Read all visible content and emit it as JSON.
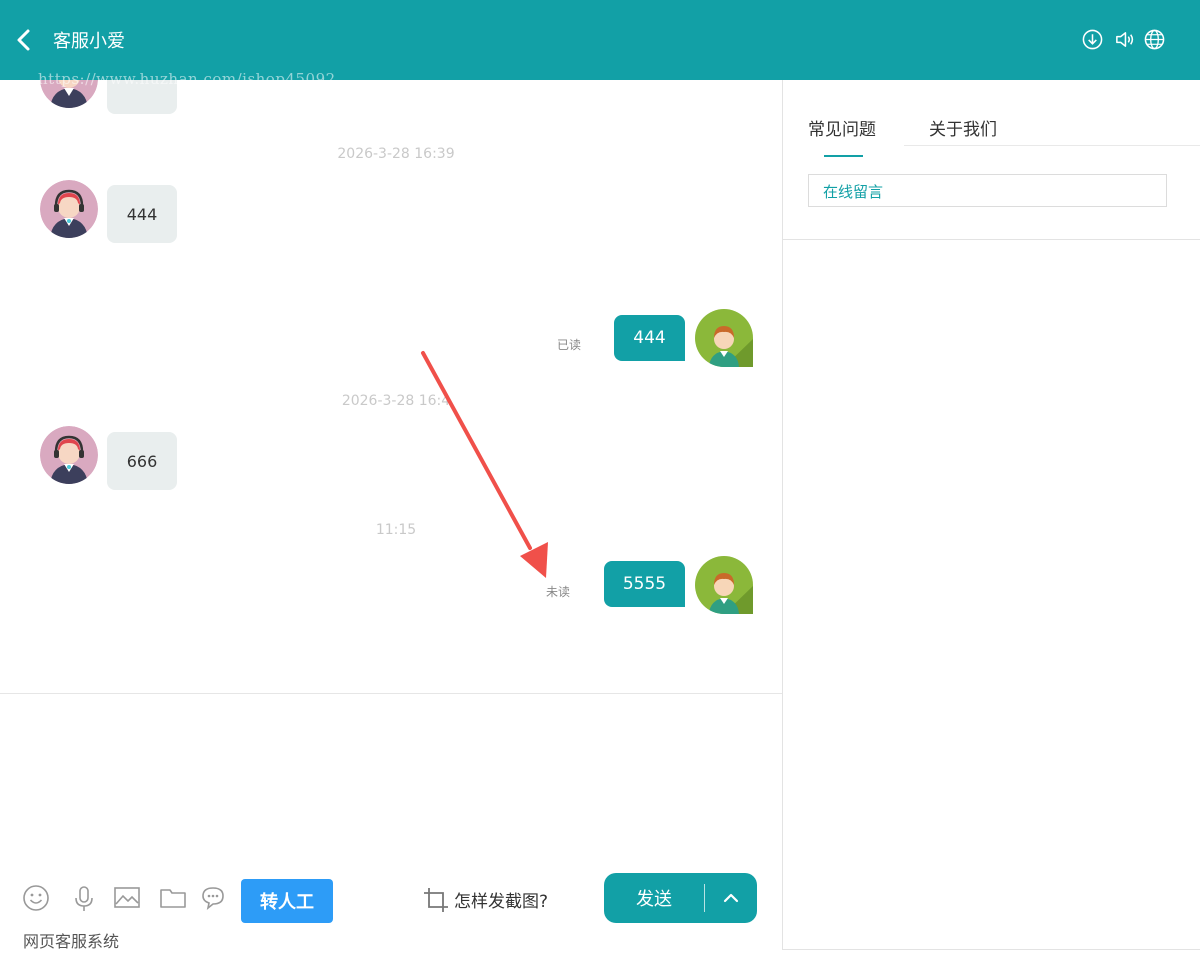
{
  "header": {
    "title": "客服小爱",
    "watermark": "https://www.huzhan.com/ishop45092",
    "icons": [
      "download-icon",
      "speaker-icon",
      "globe-icon"
    ]
  },
  "messages": {
    "time1": "2026-3-28 16:39",
    "agent_msg1": "444",
    "user_msg1": "444",
    "user_status1": "已读",
    "time2": "2026-3-28 16:4",
    "agent_msg2": "666",
    "time3": "11:15",
    "user_msg2": "5555",
    "user_status2": "未读"
  },
  "toolbar": {
    "icons": [
      "emoji-icon",
      "microphone-icon",
      "image-icon",
      "folder-icon",
      "chat-icon"
    ],
    "transfer_label": "转人工",
    "screenshot_help": "怎样发截图?",
    "send_label": "发送"
  },
  "footer": {
    "brand": "网页客服系统"
  },
  "side_panel": {
    "tabs": [
      "常见问题",
      "关于我们"
    ],
    "active_tab": "常见问题",
    "leave_message": "在线留言"
  },
  "colors": {
    "primary": "#12a0a6",
    "transfer_button": "#2d9cf7",
    "annotation_arrow": "#f0504a"
  }
}
